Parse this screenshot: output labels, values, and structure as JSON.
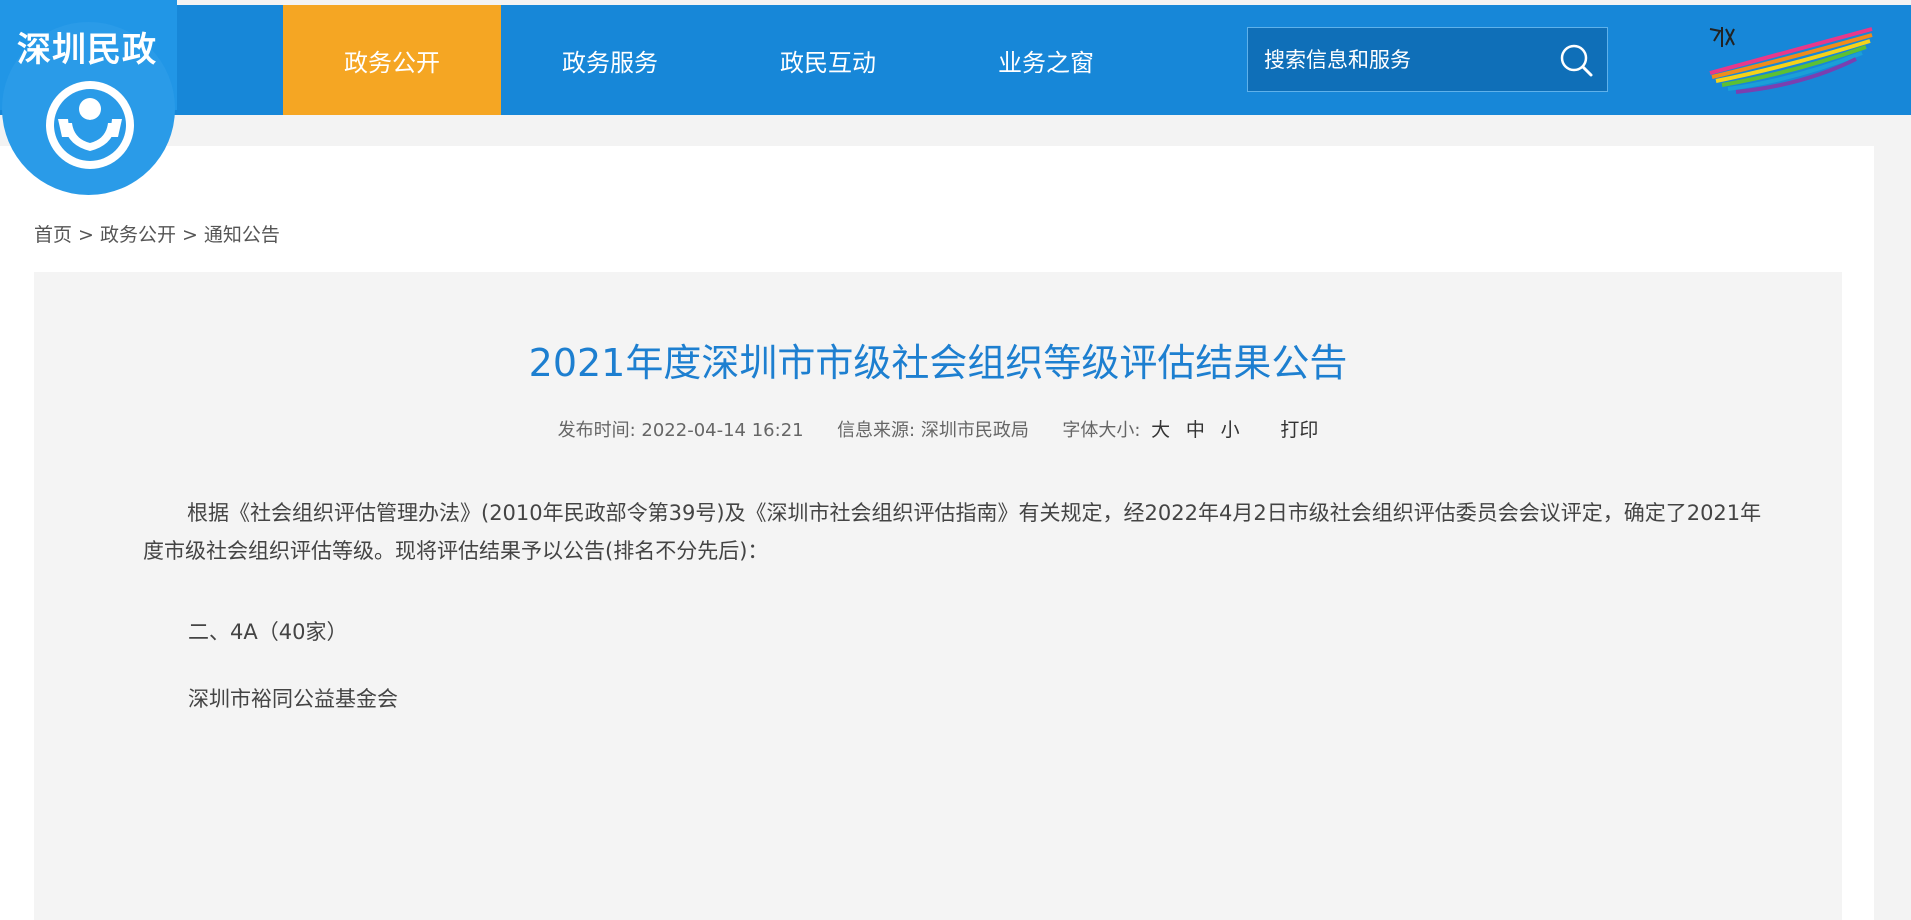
{
  "header": {
    "logo_text": "深圳民政",
    "nav": [
      {
        "label": "政务公开",
        "active": true
      },
      {
        "label": "政务服务",
        "active": false
      },
      {
        "label": "政民互动",
        "active": false
      },
      {
        "label": "业务之窗",
        "active": false
      }
    ],
    "search": {
      "placeholder": "搜索信息和服务"
    },
    "colors": {
      "bar": "#1787d8",
      "active_tab": "#f5a623",
      "title": "#1d7fd0"
    }
  },
  "breadcrumb": {
    "items": [
      "首页",
      "政务公开",
      "通知公告"
    ],
    "separator": ">"
  },
  "article": {
    "title": "2021年度深圳市市级社会组织等级评估结果公告",
    "meta": {
      "publish_label": "发布时间:",
      "publish_time": "2022-04-14 16:21",
      "source_label": "信息来源:",
      "source": "深圳市民政局",
      "font_size_label": "字体大小:",
      "size_large": "大",
      "size_medium": "中",
      "size_small": "小",
      "print": "打印"
    },
    "paragraph": "根据《社会组织评估管理办法》(2010年民政部令第39号)及《深圳市社会组织评估指南》有关规定，经2022年4月2日市级社会组织评估委员会会议评定，确定了2021年度市级社会组织评估等级。现将评估结果予以公告(排名不分先后)：",
    "section_heading": "二、4A（40家）",
    "entry": "深圳市裕同公益基金会"
  }
}
